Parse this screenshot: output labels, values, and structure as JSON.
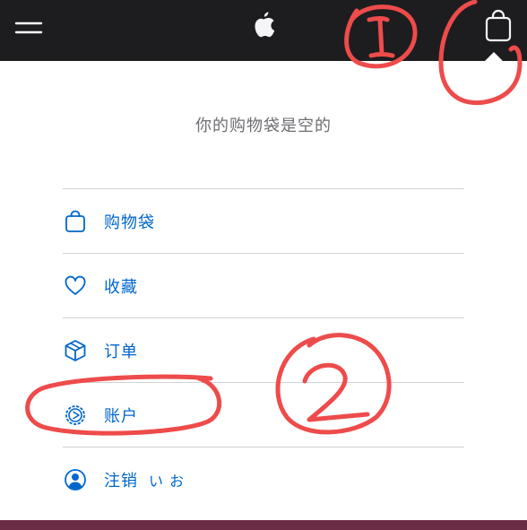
{
  "header": {
    "menu_icon": "hamburger-menu-icon",
    "logo_icon": "apple-logo-icon",
    "bag_icon": "shopping-bag-icon",
    "background": "#1d1d1f"
  },
  "bag": {
    "empty_message": "你的购物袋是空的"
  },
  "menu": {
    "items": [
      {
        "icon": "bag-icon",
        "label": "购物袋"
      },
      {
        "icon": "heart-icon",
        "label": "收藏"
      },
      {
        "icon": "box-icon",
        "label": "订单"
      },
      {
        "icon": "settings-gear-icon",
        "label": "账户"
      },
      {
        "icon": "person-icon",
        "label": "注销",
        "user": "い お"
      }
    ],
    "accent_color": "#0066cc"
  },
  "annotations": {
    "mark_1": "1",
    "mark_2": "2",
    "color": "#ee4b4b"
  }
}
